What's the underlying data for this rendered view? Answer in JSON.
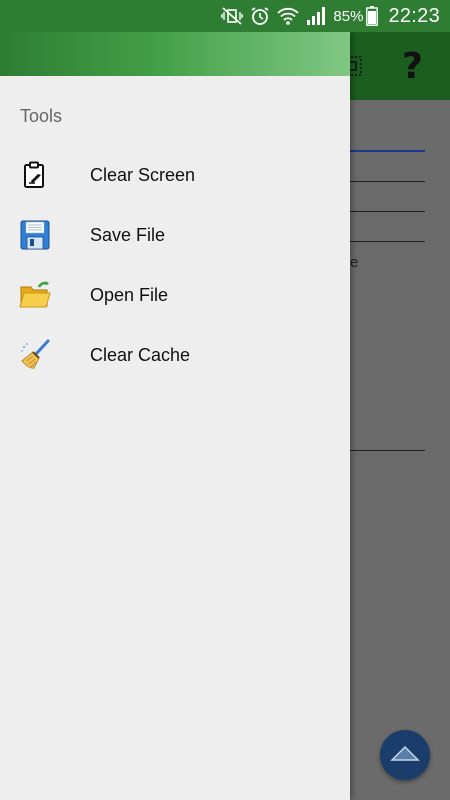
{
  "status_bar": {
    "icons": [
      "mute-vibrate-icon",
      "alarm-icon",
      "wifi-icon",
      "signal-icon"
    ],
    "battery_percent": "85%",
    "time": "22:23"
  },
  "toolbar": {
    "icons": [
      "grid-icon",
      "help-icon"
    ],
    "help_glyph": "?"
  },
  "background_app": {
    "partial_text": "e"
  },
  "drawer": {
    "section_title": "Tools",
    "items": [
      {
        "label": "Clear Screen",
        "icon": "clear-screen-icon"
      },
      {
        "label": "Save File",
        "icon": "floppy-disk-icon"
      },
      {
        "label": "Open File",
        "icon": "open-folder-icon"
      },
      {
        "label": "Clear Cache",
        "icon": "broom-icon"
      }
    ]
  },
  "fab": {
    "icon": "chevron-up-icon"
  },
  "colors": {
    "status_bar": "#2e7d32",
    "drawer_background": "#eeeeee",
    "scrim": "#6b6b6b",
    "fab": "#1a3d6b"
  }
}
